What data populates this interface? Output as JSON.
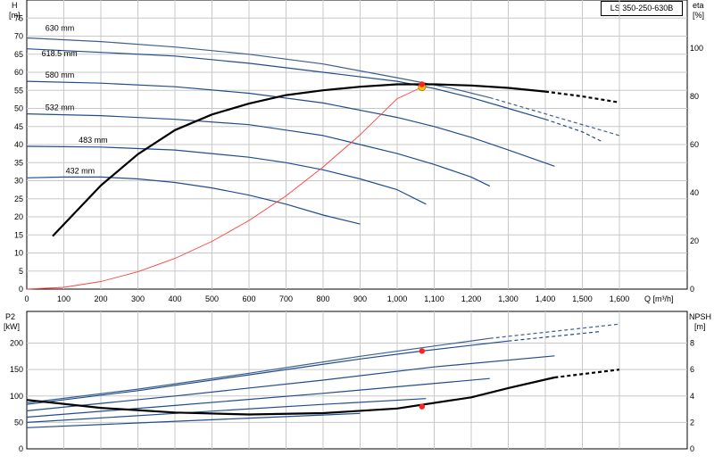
{
  "model": "LS 350-250-630B",
  "chart_data": [
    {
      "type": "line",
      "title": "",
      "xlabel": "Q [m³/h]",
      "ylabel": "H [m]",
      "ylabel_right": "eta [%]",
      "xlim": [
        0,
        1700
      ],
      "ylim": [
        0,
        80
      ],
      "ylim_right": [
        0,
        120
      ],
      "grid": true,
      "x_ticks": [
        "0",
        "100",
        "200",
        "300",
        "400",
        "500",
        "600",
        "700",
        "800",
        "900",
        "1,000",
        "1,100",
        "1,200",
        "1,300",
        "1,400",
        "1,500",
        "1,600"
      ],
      "y_ticks": [
        "0",
        "5",
        "10",
        "15",
        "20",
        "25",
        "30",
        "35",
        "40",
        "45",
        "50",
        "55",
        "60",
        "65",
        "70",
        "75"
      ],
      "y_right_ticks": [
        "0",
        "20",
        "40",
        "60",
        "80",
        "100"
      ],
      "series": [
        {
          "name": "630 mm",
          "color": "#3d5f8f",
          "x": [
            0,
            200,
            400,
            600,
            800,
            1000,
            1150,
            1250,
            1350,
            1450,
            1550,
            1600
          ],
          "y": [
            69.5,
            68.5,
            67,
            65,
            62.3,
            58.5,
            55.5,
            53,
            50,
            47,
            44,
            42.5
          ],
          "dashed_from": 1250
        },
        {
          "name": "618.5 mm",
          "color": "#1f4d8f",
          "x": [
            0,
            200,
            400,
            600,
            800,
            1000,
            1100,
            1200,
            1300,
            1400,
            1500,
            1550
          ],
          "y": [
            66.5,
            65.5,
            64.5,
            62.5,
            60,
            57.5,
            55.5,
            53,
            50,
            47,
            43.5,
            41
          ],
          "dashed_from": 1430
        },
        {
          "name": "580 mm",
          "color": "#1f4d8f",
          "x": [
            0,
            200,
            400,
            600,
            800,
            1000,
            1100,
            1200,
            1300,
            1425
          ],
          "y": [
            57.5,
            57,
            56,
            54.2,
            51.5,
            47.5,
            45,
            42,
            38.5,
            34
          ]
        },
        {
          "name": "532 mm",
          "color": "#1f4d8f",
          "x": [
            0,
            200,
            400,
            600,
            700,
            800,
            900,
            1000,
            1100,
            1200,
            1250
          ],
          "y": [
            48.5,
            48,
            47,
            45.5,
            44,
            42.5,
            40,
            37.5,
            34.5,
            31,
            28.5
          ]
        },
        {
          "name": "483 mm",
          "color": "#1f4d8f",
          "x": [
            0,
            200,
            400,
            600,
            700,
            800,
            900,
            1000,
            1078
          ],
          "y": [
            39.5,
            39.3,
            38.5,
            36.5,
            35,
            33,
            30.5,
            27.5,
            23.5
          ]
        },
        {
          "name": "432 mm",
          "color": "#1f4d8f",
          "x": [
            0,
            100,
            200,
            300,
            400,
            500,
            600,
            700,
            800,
            900
          ],
          "y": [
            30.8,
            31,
            31,
            30.5,
            29.5,
            28,
            26,
            23.5,
            20.5,
            18
          ]
        },
        {
          "name": "",
          "color": "#ff4040",
          "x": [
            0,
            100,
            200,
            300,
            400,
            500,
            600,
            700,
            800,
            900,
            1000,
            1067
          ],
          "y": [
            0,
            0.5,
            2.1,
            4.8,
            8.5,
            13.2,
            19,
            25.8,
            33.8,
            42.7,
            52.7,
            55.9
          ]
        },
        {
          "name": "",
          "color": "#000000",
          "x": [
            70,
            200,
            300,
            400,
            500,
            600,
            700,
            800,
            900,
            1000,
            1100,
            1200,
            1300,
            1400,
            1500,
            1600
          ],
          "y_right": [
            22,
            43,
            56,
            66,
            72.5,
            77,
            80.5,
            82.5,
            84,
            85,
            85,
            84.5,
            83.5,
            82,
            80,
            77.5
          ],
          "dashed_from": 1430
        }
      ],
      "annotations": [
        {
          "text": "630 mm",
          "x": 50,
          "y": 71.5
        },
        {
          "text": "618.5 mm",
          "x": 40,
          "y": 64.5
        },
        {
          "text": "580 mm",
          "x": 50,
          "y": 58.5
        },
        {
          "text": "532 mm",
          "x": 50,
          "y": 49.5
        },
        {
          "text": "483 mm",
          "x": 140,
          "y": 40.5
        },
        {
          "text": "432 mm",
          "x": 105,
          "y": 32
        }
      ],
      "points": [
        {
          "x": 1067,
          "y": 55.9,
          "color": "#ffc000"
        },
        {
          "x": 1067,
          "y_right": 85,
          "color": "#ff2020"
        }
      ]
    },
    {
      "type": "line",
      "title": "",
      "xlabel": "",
      "ylabel": "P2 [kW]",
      "ylabel_right": "NPSH [m]",
      "xlim": [
        0,
        1700
      ],
      "ylim": [
        0,
        260
      ],
      "ylim_right": [
        0,
        10.4
      ],
      "grid": true,
      "y_ticks": [
        "0",
        "50",
        "100",
        "150",
        "200"
      ],
      "y_right_ticks": [
        "0",
        "2",
        "4",
        "6",
        "8"
      ],
      "series": [
        {
          "name": "",
          "color": "#1f4d8f",
          "x": [
            0,
            300,
            600,
            900,
            1067,
            1300,
            1550
          ],
          "y": [
            84,
            110,
            140,
            170,
            185,
            204,
            222
          ],
          "dashed_from": 1430
        },
        {
          "name": "",
          "color": "#3d5f8f",
          "x": [
            0,
            300,
            600,
            900,
            1250,
            1600
          ],
          "y": [
            87,
            113,
            143,
            175,
            209,
            236
          ],
          "dashed_from": 1250
        },
        {
          "name": "",
          "color": "#1f4d8f",
          "x": [
            0,
            400,
            800,
            1100,
            1425
          ],
          "y": [
            72,
            100,
            130,
            155,
            176
          ]
        },
        {
          "name": "",
          "color": "#1f4d8f",
          "x": [
            0,
            400,
            800,
            1250
          ],
          "y": [
            60,
            82,
            105,
            133
          ]
        },
        {
          "name": "",
          "color": "#1f4d8f",
          "x": [
            0,
            400,
            800,
            1078
          ],
          "y": [
            50,
            67,
            84,
            95
          ]
        },
        {
          "name": "",
          "color": "#1f4d8f",
          "x": [
            0,
            300,
            600,
            900
          ],
          "y": [
            40,
            49,
            58,
            67
          ]
        },
        {
          "name": "",
          "color": "#000000",
          "x": [
            0,
            200,
            400,
            600,
            800,
            1000,
            1200,
            1300,
            1425,
            1600
          ],
          "y_right": [
            3.7,
            3.1,
            2.75,
            2.6,
            2.7,
            3.05,
            3.9,
            4.6,
            5.4,
            6.0
          ],
          "dashed_from": 1430
        }
      ],
      "points": [
        {
          "x": 1067,
          "y": 185,
          "color": "#ff2020"
        },
        {
          "x": 1067,
          "y_right": 3.2,
          "color": "#ff2020"
        }
      ]
    }
  ]
}
